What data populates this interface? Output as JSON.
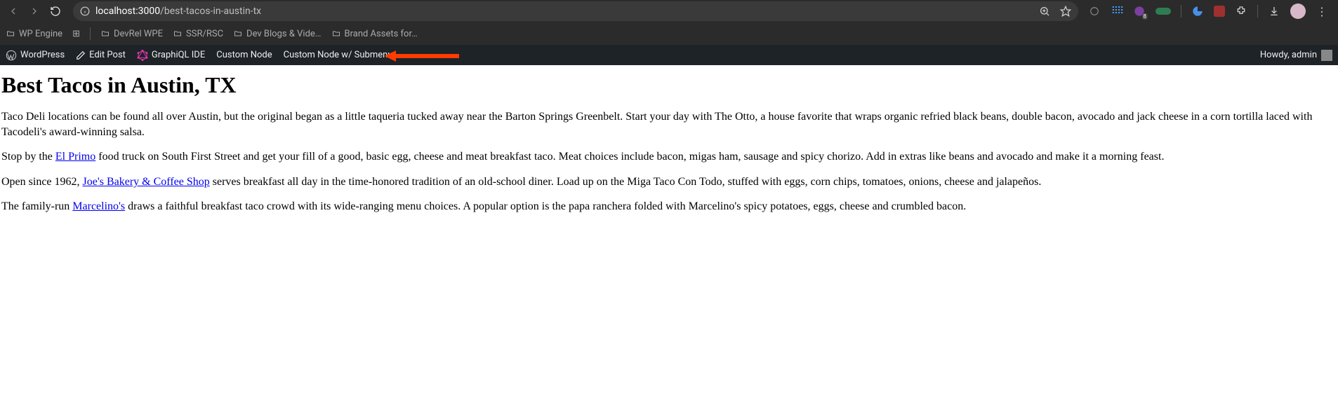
{
  "browser": {
    "url_host": "localhost:3000",
    "url_path": "/best-tacos-in-austin-tx",
    "bookmarks": [
      {
        "label": "WP Engine"
      },
      {
        "label": "DevRel WPE"
      },
      {
        "label": "SSR/RSC"
      },
      {
        "label": "Dev Blogs & Vide…"
      },
      {
        "label": "Brand Assets for…"
      }
    ],
    "extension_badge": "8"
  },
  "wp_bar": {
    "items": [
      {
        "id": "wordpress",
        "label": "WordPress"
      },
      {
        "id": "edit-post",
        "label": "Edit Post"
      },
      {
        "id": "graphiql-ide",
        "label": "GraphiQL IDE"
      },
      {
        "id": "custom-node",
        "label": "Custom Node"
      },
      {
        "id": "custom-node-submenu",
        "label": "Custom Node w/ Submenu"
      }
    ],
    "howdy": "Howdy, admin"
  },
  "page": {
    "title": "Best Tacos in Austin, TX",
    "p1": "Taco Deli locations can be found all over Austin, but the original began as a little taqueria tucked away near the Barton Springs Greenbelt. Start your day with The Otto, a house favorite that wraps organic refried black beans, double bacon, avocado and jack cheese in a corn tortilla laced with Tacodeli's award-winning salsa.",
    "p2a": "Stop by the ",
    "p2_link": "El Primo",
    "p2b": " food truck on South First Street and get your fill of a good, basic egg, cheese and meat breakfast taco. Meat choices include bacon, migas ham, sausage and spicy chorizo. Add in extras like beans and avocado and make it a morning feast.",
    "p3a": "Open since 1962, ",
    "p3_link": "Joe's Bakery & Coffee Shop",
    "p3b": " serves breakfast all day in the time-honored tradition of an old-school diner. Load up on the Miga Taco Con Todo, stuffed with eggs, corn chips, tomatoes, onions, cheese and jalapeños.",
    "p4a": "The family-run ",
    "p4_link": "Marcelino's",
    "p4b": " draws a faithful breakfast taco crowd with its wide-ranging menu choices. A popular option is the papa ranchera folded with Marcelino's spicy potatoes, eggs, cheese and crumbled bacon."
  }
}
